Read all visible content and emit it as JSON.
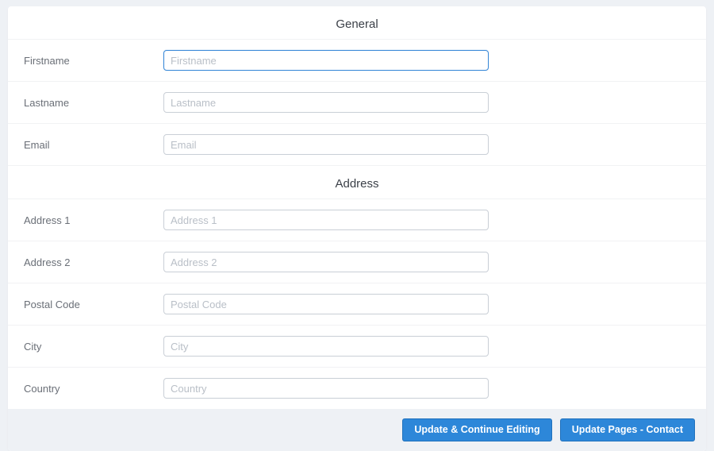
{
  "sections": {
    "general": {
      "title": "General",
      "fields": {
        "firstname": {
          "label": "Firstname",
          "placeholder": "Firstname",
          "value": ""
        },
        "lastname": {
          "label": "Lastname",
          "placeholder": "Lastname",
          "value": ""
        },
        "email": {
          "label": "Email",
          "placeholder": "Email",
          "value": ""
        }
      }
    },
    "address": {
      "title": "Address",
      "fields": {
        "address1": {
          "label": "Address 1",
          "placeholder": "Address 1",
          "value": ""
        },
        "address2": {
          "label": "Address 2",
          "placeholder": "Address 2",
          "value": ""
        },
        "postalcode": {
          "label": "Postal Code",
          "placeholder": "Postal Code",
          "value": ""
        },
        "city": {
          "label": "City",
          "placeholder": "City",
          "value": ""
        },
        "country": {
          "label": "Country",
          "placeholder": "Country",
          "value": ""
        }
      }
    }
  },
  "footer": {
    "update_continue": "Update & Continue Editing",
    "update_pages": "Update Pages - Contact"
  }
}
